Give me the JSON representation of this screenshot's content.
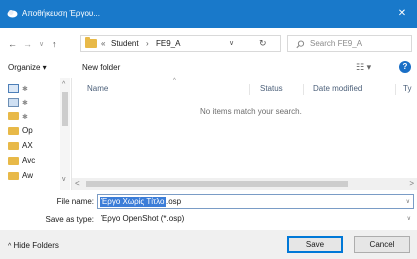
{
  "window": {
    "title": "Αποθήκευση Έργου...",
    "close_glyph": "✕"
  },
  "address": {
    "back_glyph": "←",
    "forward_glyph": "→",
    "recent_glyph": "∨",
    "up_glyph": "↑",
    "overflow": "«",
    "crumbs": [
      "Student",
      "FE9_A"
    ],
    "separator": "›",
    "dropdown_glyph": "∨",
    "refresh_glyph": "↻",
    "search_placeholder": "Search FE9_A"
  },
  "toolbar": {
    "organize": "Organize ▾",
    "new_folder": "New folder",
    "view_glyph": "☷ ▾",
    "help_glyph": "?"
  },
  "nav_pane": {
    "items": [
      "Op",
      "AX",
      "Avc",
      "Aw"
    ]
  },
  "file_pane": {
    "columns": [
      "Name",
      "Status",
      "Date modified",
      "Ty"
    ],
    "empty_message": "No items match your search."
  },
  "form": {
    "file_name_label": "File name:",
    "file_name_selected": "Έργο Χωρίς Τίτλο",
    "file_name_ext": ".osp",
    "save_type_label": "Save as type:",
    "save_type_value": "Έργο OpenShot (*.osp)"
  },
  "footer": {
    "hide_folders": "Hide Folders",
    "save": "Save",
    "cancel": "Cancel"
  },
  "colors": {
    "titlebar": "#1979ca",
    "selection": "#3b7dd8",
    "primary_border": "#0078d7"
  }
}
